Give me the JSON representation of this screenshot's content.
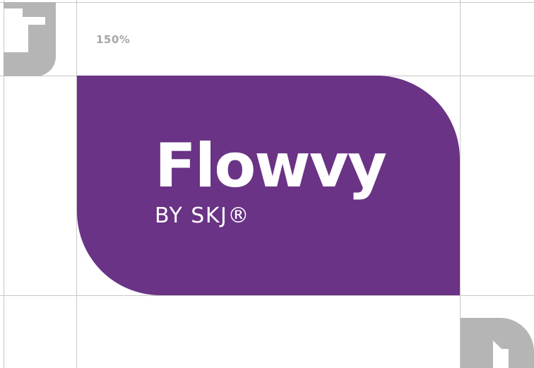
{
  "scale_label": "150%",
  "logo": {
    "wordmark": "Flowvy",
    "subtitle": "BY SKJ®"
  },
  "colors": {
    "brand_purple": "#6a3386",
    "mark_gray": "#b5b5b5",
    "guide_gray": "#c8c8c8",
    "label_gray": "#a6a6a6",
    "text_white": "#ffffff"
  },
  "icons": {
    "top_left": "skj-j-mark-icon",
    "bottom_right": "skj-d-mark-icon"
  }
}
